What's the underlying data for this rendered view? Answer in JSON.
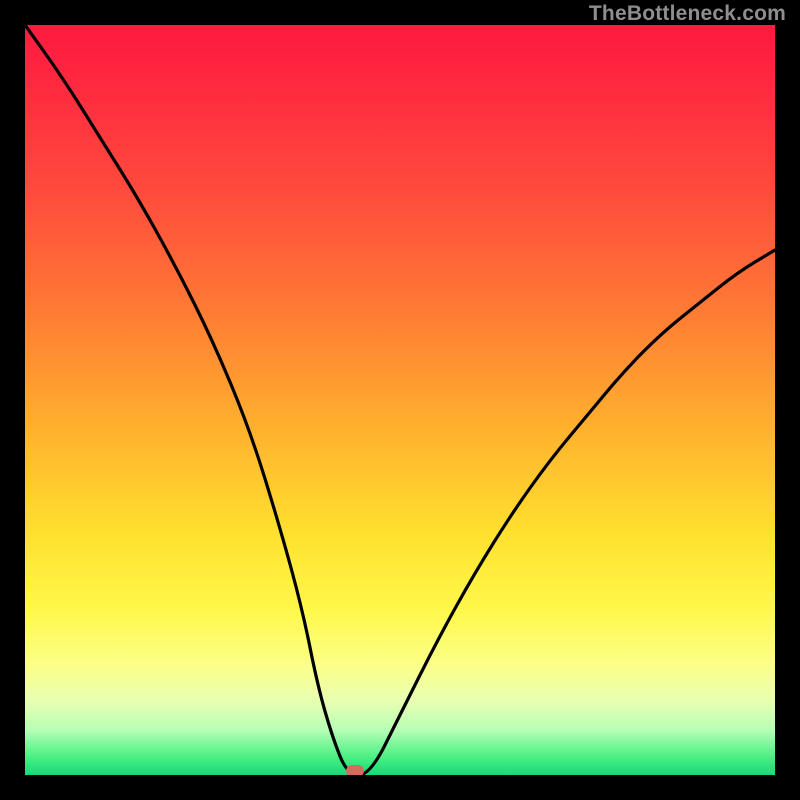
{
  "watermark": "TheBottleneck.com",
  "colors": {
    "frame_bg": "#000000",
    "curve": "#000000",
    "marker": "#d66a5e",
    "gradient_top": "#ff1a3f",
    "gradient_bottom": "#14da7a"
  },
  "chart_data": {
    "type": "line",
    "title": "",
    "xlabel": "",
    "ylabel": "",
    "xlim": [
      0,
      100
    ],
    "ylim": [
      0,
      100
    ],
    "note": "x is horizontal position in percent of plot width; y is bottleneck percentage (0 at bottom/green, 100 at top/red). Curve is a V reaching ~0 near x≈43.",
    "series": [
      {
        "name": "bottleneck-curve",
        "x": [
          0,
          5,
          10,
          15,
          20,
          25,
          30,
          34,
          37,
          39,
          41,
          43,
          46,
          50,
          55,
          60,
          65,
          70,
          75,
          80,
          85,
          90,
          95,
          100
        ],
        "y": [
          100,
          93,
          85,
          77,
          68,
          58,
          46,
          33,
          22,
          12,
          5,
          0,
          0,
          8,
          18,
          27,
          35,
          42,
          48,
          54,
          59,
          63,
          67,
          70
        ]
      }
    ],
    "marker": {
      "x": 44,
      "y": 0.5
    },
    "grid": false
  }
}
